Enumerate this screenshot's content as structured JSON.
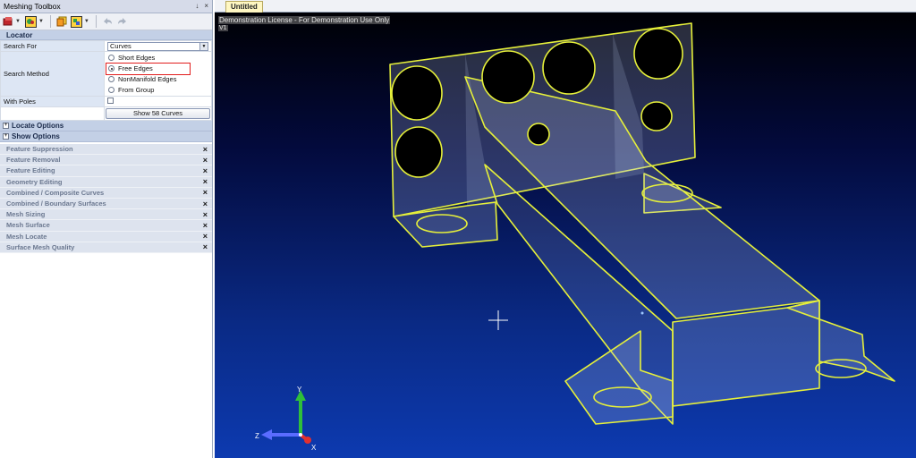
{
  "panel": {
    "title": "Meshing Toolbox",
    "title_buttons": [
      "↓",
      "×"
    ]
  },
  "locator": {
    "header": "Locator",
    "search_for_label": "Search For",
    "search_for_value": "Curves",
    "search_method_label": "Search Method",
    "methods": [
      "Short Edges",
      "Free Edges",
      "NonManifold Edges",
      "From Group"
    ],
    "selected_method": "Free Edges",
    "with_poles_label": "With Poles",
    "show_button": "Show 58 Curves"
  },
  "subsections": [
    "Locate Options",
    "Show Options"
  ],
  "tools": [
    "Feature Suppression",
    "Feature Removal",
    "Feature Editing",
    "Geometry Editing",
    "Combined / Composite Curves",
    "Combined / Boundary Surfaces",
    "Mesh Sizing",
    "Mesh Surface",
    "Mesh Locate",
    "Surface Mesh Quality"
  ],
  "close_glyph": "×",
  "viewport": {
    "tab": "Untitled",
    "license_text": "Demonstration License - For Demonstration Use Only",
    "view_label": "V1"
  },
  "axes": {
    "y": "Y",
    "z": "Z",
    "x": "X"
  },
  "colors": {
    "accent_highlight": "#e21c1c",
    "model_edges": "#e6f03a",
    "axis_y": "#2fbf3a",
    "axis_z": "#5a6cff",
    "axis_x": "#e03030"
  }
}
